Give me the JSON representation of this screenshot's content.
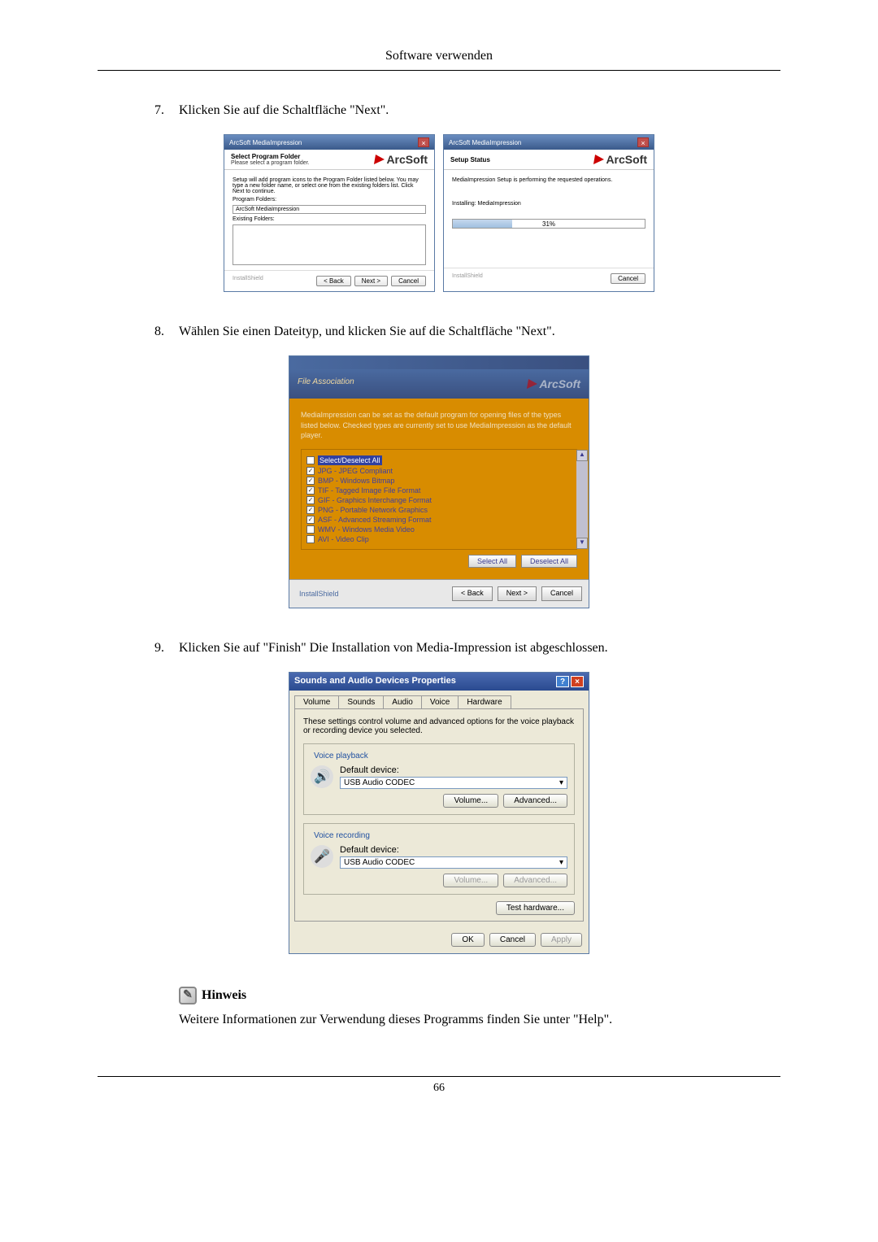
{
  "header": {
    "title": "Software verwenden"
  },
  "steps": {
    "s7": {
      "num": "7.",
      "text": "Klicken Sie auf die Schaltfläche \"Next\"."
    },
    "s8": {
      "num": "8.",
      "text": "Wählen Sie einen Dateityp, und klicken Sie auf die Schaltfläche \"Next\"."
    },
    "s9": {
      "num": "9.",
      "text": "Klicken Sie auf \"Finish\" Die Installation von Media-Impression ist abgeschlossen."
    }
  },
  "dlg1": {
    "title": "ArcSoft MediaImpression",
    "sub_title": "Select Program Folder",
    "sub_desc": "Please select a program folder.",
    "logo": "ArcSoft",
    "body_desc": "Setup will add program icons to the Program Folder listed below. You may type a new folder name, or select one from the existing folders list. Click Next to continue.",
    "label_folder": "Program Folders:",
    "folder_value": "ArcSoft MediaImpression",
    "label_existing": "Existing Folders:",
    "shield": "InstallShield",
    "btn_back": "< Back",
    "btn_next": "Next >",
    "btn_cancel": "Cancel"
  },
  "dlg2": {
    "title": "ArcSoft MediaImpression",
    "sub_title": "Setup Status",
    "logo": "ArcSoft",
    "body_desc": "MediaImpression Setup is performing the requested operations.",
    "installing": "Installing: MediaImpression",
    "progress": "31%",
    "shield": "InstallShield",
    "btn_cancel": "Cancel"
  },
  "step8img": {
    "heading": "File Association",
    "desc": "MediaImpression can be set as the default program for opening files of the types listed below. Checked types are currently set to use MediaImpression as the default player.",
    "items": [
      "Select/Deselect All",
      "JPG - JPEG Compliant",
      "BMP - Windows Bitmap",
      "TIF - Tagged Image File Format",
      "GIF - Graphics Interchange Format",
      "PNG - Portable Network Graphics",
      "ASF - Advanced Streaming Format",
      "WMV - Windows Media Video",
      "AVI - Video Clip"
    ],
    "btn_sel": "Select All",
    "btn_desel": "Deselect All",
    "shield": "InstallShield",
    "btn_back": "< Back",
    "btn_next": "Next >",
    "btn_cancel": "Cancel"
  },
  "snd": {
    "title": "Sounds and Audio Devices Properties",
    "tabs": [
      "Volume",
      "Sounds",
      "Audio",
      "Voice",
      "Hardware"
    ],
    "active_tab": "Voice",
    "desc": "These settings control volume and advanced options for the voice playback or recording device you selected.",
    "playback": {
      "legend": "Voice playback",
      "label": "Default device:",
      "value": "USB Audio CODEC",
      "btn_vol": "Volume...",
      "btn_adv": "Advanced..."
    },
    "recording": {
      "legend": "Voice recording",
      "label": "Default device:",
      "value": "USB Audio CODEC",
      "btn_vol": "Volume...",
      "btn_adv": "Advanced..."
    },
    "btn_test": "Test hardware...",
    "btn_ok": "OK",
    "btn_cancel": "Cancel",
    "btn_apply": "Apply"
  },
  "hinweis": {
    "label": "Hinweis",
    "text": "Weitere Informationen zur Verwendung dieses Programms finden Sie unter \"Help\"."
  },
  "page_number": "66"
}
